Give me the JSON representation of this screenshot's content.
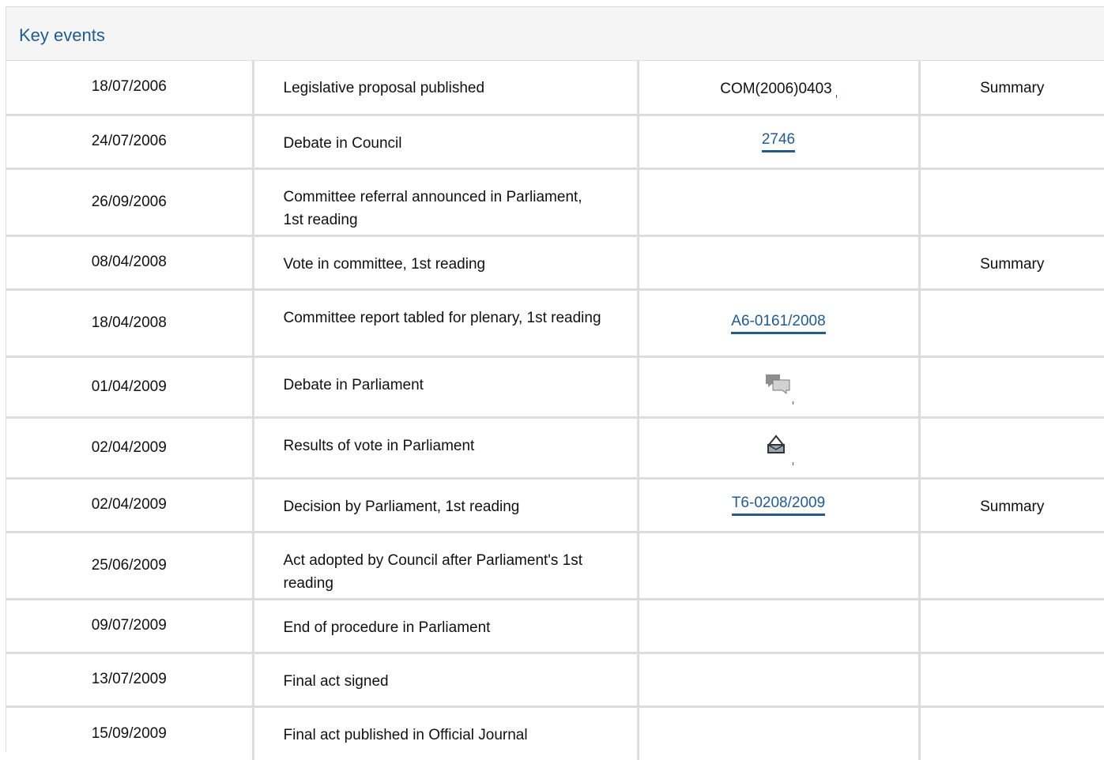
{
  "panel": {
    "title": "Key events"
  },
  "events": [
    {
      "date": "18/07/2006",
      "event": "Legislative proposal published",
      "doc": "COM(2006)0403",
      "doc_type": "text",
      "summary": "Summary"
    },
    {
      "date": "24/07/2006",
      "event": "Debate in Council",
      "doc": "2746",
      "doc_type": "link",
      "summary": ""
    },
    {
      "date": "26/09/2006",
      "event": "Committee referral announced in Parliament, 1st reading",
      "doc": "",
      "doc_type": "none",
      "summary": ""
    },
    {
      "date": "08/04/2008",
      "event": "Vote in committee, 1st reading",
      "doc": "",
      "doc_type": "none",
      "summary": "Summary"
    },
    {
      "date": "18/04/2008",
      "event": "Committee report tabled for plenary, 1st reading",
      "doc": "A6-0161/2008",
      "doc_type": "link",
      "summary": ""
    },
    {
      "date": "01/04/2009",
      "event": "Debate in Parliament",
      "doc": "",
      "doc_type": "debate-icon",
      "summary": ""
    },
    {
      "date": "02/04/2009",
      "event": "Results of vote in Parliament",
      "doc": "",
      "doc_type": "vote-icon",
      "summary": ""
    },
    {
      "date": "02/04/2009",
      "event": "Decision by Parliament, 1st reading",
      "doc": "T6-0208/2009",
      "doc_type": "link",
      "summary": "Summary"
    },
    {
      "date": "25/06/2009",
      "event": "Act adopted by Council after Parliament's 1st reading",
      "doc": "",
      "doc_type": "none",
      "summary": ""
    },
    {
      "date": "09/07/2009",
      "event": "End of procedure in Parliament",
      "doc": "",
      "doc_type": "none",
      "summary": ""
    },
    {
      "date": "13/07/2009",
      "event": "Final act signed",
      "doc": "",
      "doc_type": "none",
      "summary": ""
    },
    {
      "date": "15/09/2009",
      "event": "Final act published in Official Journal",
      "doc": "",
      "doc_type": "none",
      "summary": ""
    }
  ],
  "colors": {
    "link": "#235b8f",
    "header_bg": "#f5f5f5",
    "border": "#dcdcdc"
  }
}
